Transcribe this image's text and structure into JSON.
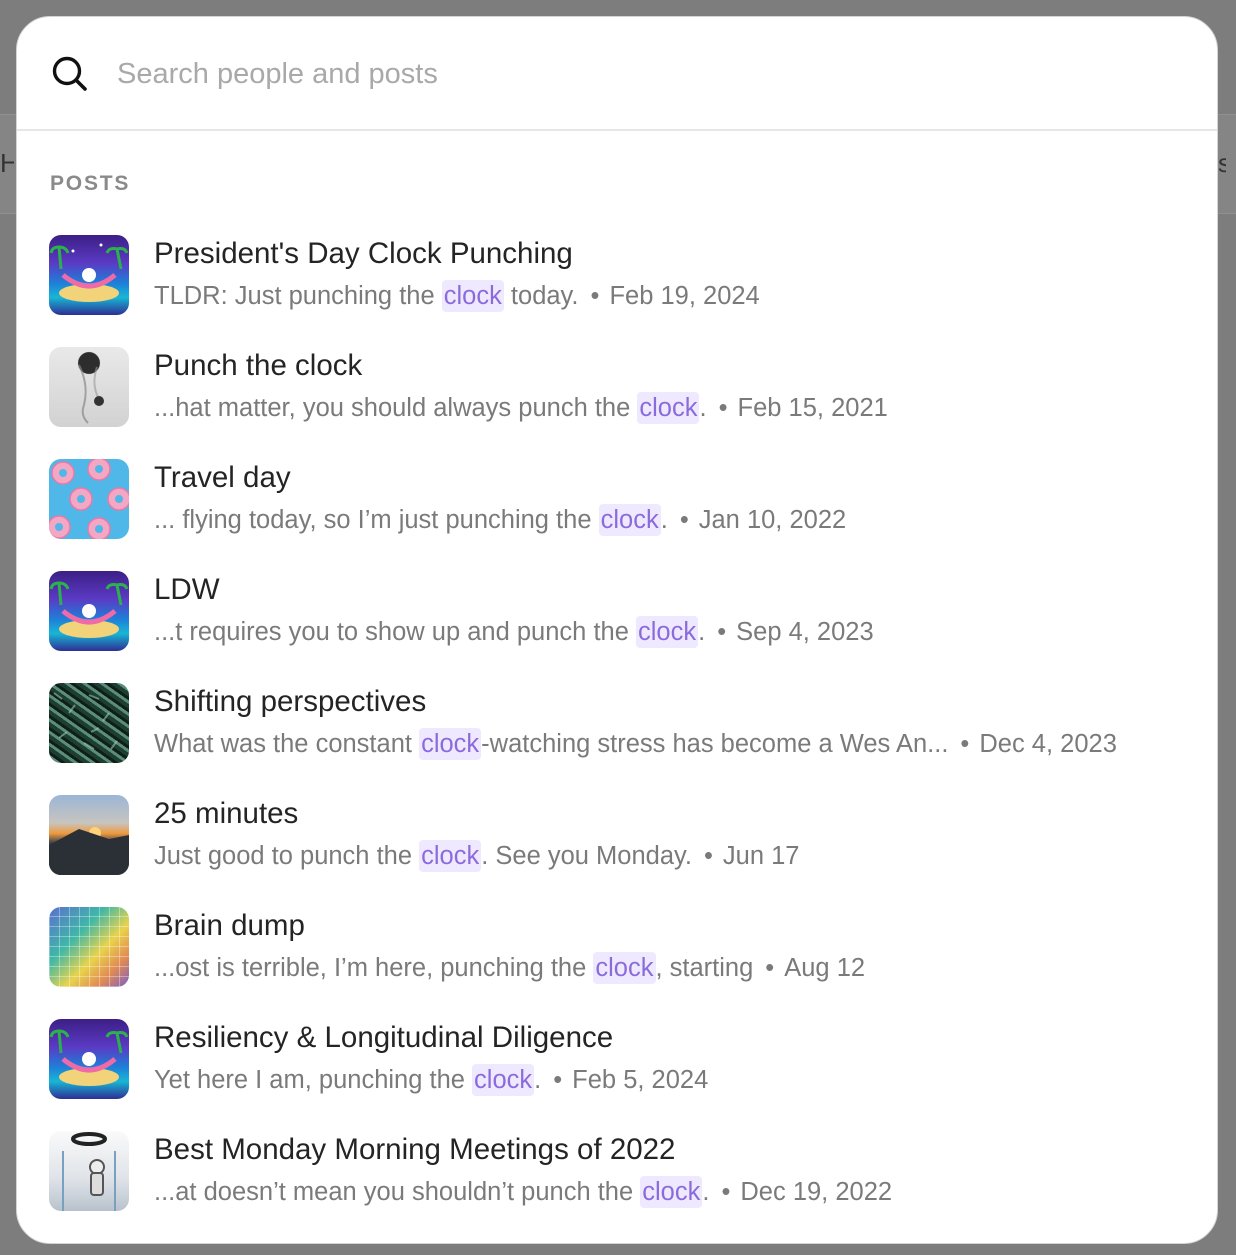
{
  "search": {
    "placeholder": "Search people and posts",
    "value": ""
  },
  "background": {
    "left_fragment": "H",
    "right_fragment": "s"
  },
  "section_label": "POSTS",
  "highlight_color": "#8b6bdc",
  "results": [
    {
      "thumb": "beach-hammock-illustration",
      "title": "President's Day Clock Punching",
      "pre": "TLDR: Just punching the ",
      "match": "clock",
      "post": " today.",
      "date": "Feb 19, 2024"
    },
    {
      "thumb": "smoke-figure-photo",
      "title": "Punch the clock",
      "pre": "...hat matter, you should always punch the ",
      "match": "clock",
      "post": ".",
      "date": "Feb 15, 2021"
    },
    {
      "thumb": "donut-pattern",
      "title": "Travel day",
      "pre": "... flying today, so I’m just punching the ",
      "match": "clock",
      "post": ".",
      "date": "Jan 10, 2022"
    },
    {
      "thumb": "beach-hammock-illustration",
      "title": "LDW",
      "pre": "...t requires you to show up and punch the ",
      "match": "clock",
      "post": ".",
      "date": "Sep 4, 2023"
    },
    {
      "thumb": "green-noise-pattern",
      "title": "Shifting perspectives",
      "pre": "What was the constant ",
      "match": "clock",
      "post": "-watching stress has become a Wes An...",
      "date": "Dec 4, 2023"
    },
    {
      "thumb": "sunset-photo",
      "title": "25 minutes",
      "pre": "Just good to punch the ",
      "match": "clock",
      "post": ". See you Monday.",
      "date": "Jun 17"
    },
    {
      "thumb": "color-grid-chart",
      "title": "Brain dump",
      "pre": "...ost is terrible, I’m here, punching the ",
      "match": "clock",
      "post": ", starting",
      "date": "Aug 12"
    },
    {
      "thumb": "beach-hammock-illustration",
      "title": "Resiliency & Longitudinal Diligence",
      "pre": "Yet here I am, punching the ",
      "match": "clock",
      "post": ".",
      "date": "Feb 5, 2024"
    },
    {
      "thumb": "astronaut-illustration",
      "title": "Best Monday Morning Meetings of 2022",
      "pre": "...at doesn’t mean you shouldn’t punch the ",
      "match": "clock",
      "post": ".",
      "date": "Dec 19, 2022"
    }
  ]
}
